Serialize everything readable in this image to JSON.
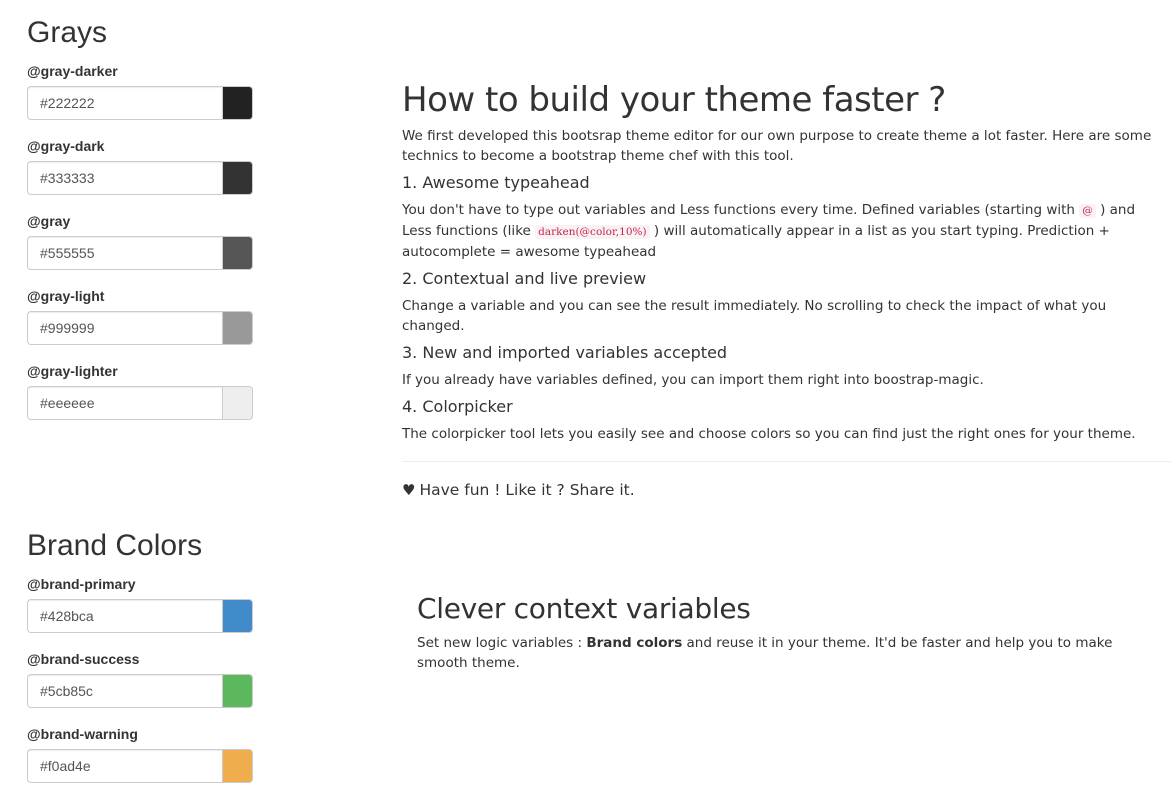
{
  "grays": {
    "title": "Grays",
    "vars": [
      {
        "name": "@gray-darker",
        "value": "#222222",
        "color": "#222222"
      },
      {
        "name": "@gray-dark",
        "value": "#333333",
        "color": "#333333"
      },
      {
        "name": "@gray",
        "value": "#555555",
        "color": "#555555"
      },
      {
        "name": "@gray-light",
        "value": "#999999",
        "color": "#999999"
      },
      {
        "name": "@gray-lighter",
        "value": "#eeeeee",
        "color": "#eeeeee"
      }
    ]
  },
  "brand": {
    "title": "Brand Colors",
    "vars": [
      {
        "name": "@brand-primary",
        "value": "#428bca",
        "color": "#428bca"
      },
      {
        "name": "@brand-success",
        "value": "#5cb85c",
        "color": "#5cb85c"
      },
      {
        "name": "@brand-warning",
        "value": "#f0ad4e",
        "color": "#f0ad4e"
      }
    ]
  },
  "howto": {
    "title": "How to build your theme faster ?",
    "intro": "We first developed this bootsrap theme editor for our own purpose to create theme a lot faster. Here are some technics to become a bootstrap theme chef with this tool.",
    "sections": [
      {
        "heading": "1. Awesome typeahead",
        "text_a": "You don't have to type out variables and Less functions every time. Defined variables (starting with ",
        "code_a": "@",
        "text_b": " ) and Less functions (like ",
        "code_b": "darken(@color,10%)",
        "text_c": " ) will automatically appear in a list as you start typing. Prediction + autocomplete = awesome typeahead"
      },
      {
        "heading": "2. Contextual and live preview",
        "text": "Change a variable and you can see the result immediately. No scrolling to check the impact of what you changed."
      },
      {
        "heading": "3. New and imported variables accepted",
        "text": "If you already have variables defined, you can import them right into boostrap-magic."
      },
      {
        "heading": "4. Colorpicker",
        "text": "The colorpicker tool lets you easily see and choose colors so you can find just the right ones for your theme."
      }
    ],
    "fun": "Have fun ! Like it ? Share it.",
    "heart_icon": "heart-icon"
  },
  "clever": {
    "title": "Clever context variables",
    "text_a": "Set new logic variables : ",
    "strong": "Brand colors",
    "text_b": " and reuse it in your theme. It'd be faster and help you to make smooth theme."
  }
}
